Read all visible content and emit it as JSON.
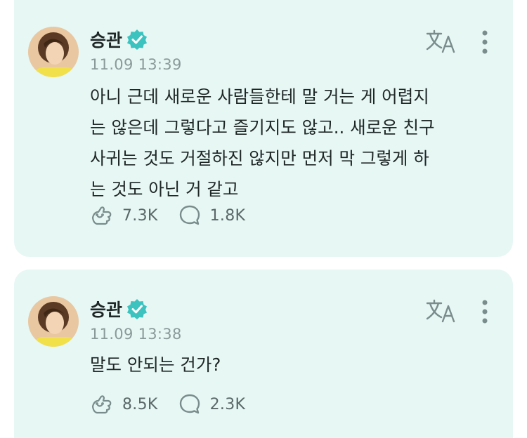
{
  "posts": [
    {
      "author": "승관",
      "time": "11.09 13:39",
      "text": "아니 근데 새로운 사람들한테 말 거는 게 어렵지\n는 않은데 그렇다고 즐기지도 않고.. 새로운 친구\n사귀는 것도 거절하진 않지만 먼저 막 그렇게 하\n는 것도 아닌 거 같고",
      "likes": "7.3K",
      "comments": "1.8K"
    },
    {
      "author": "승관",
      "time": "11.09 13:38",
      "text": "말도 안되는 건가?",
      "likes": "8.5K",
      "comments": "2.3K"
    }
  ],
  "colors": {
    "card_bg": "#e6f7f4",
    "verified": "#3cc3c0",
    "icon": "#7a8c8b"
  },
  "icons": {
    "verified": "verified-badge-icon",
    "translate": "translate-icon",
    "more": "more-vertical-icon",
    "like": "paw-like-icon",
    "comment": "comment-bubble-icon"
  }
}
